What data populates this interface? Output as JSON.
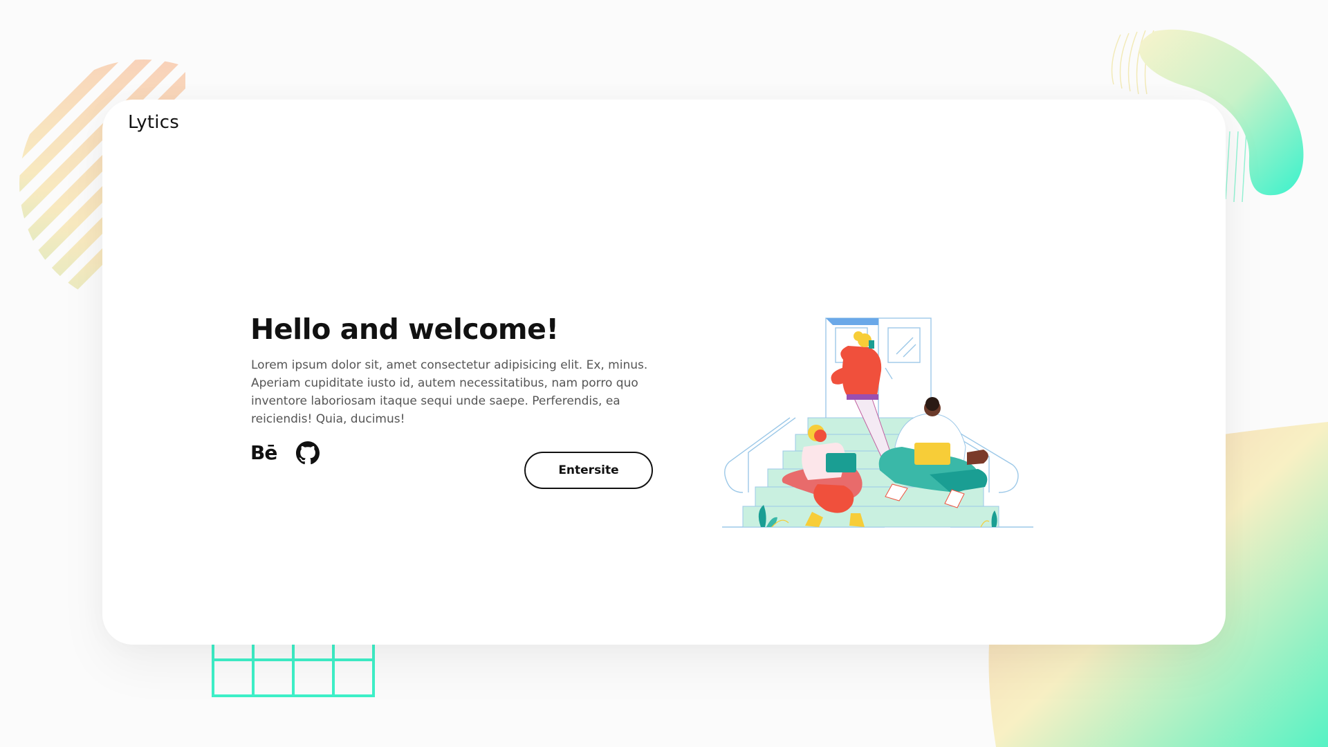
{
  "brand": {
    "logo": "Lytics"
  },
  "hero": {
    "title": "Hello and welcome!",
    "text": "Lorem ipsum dolor sit, amet consectetur adipisicing elit. Ex, minus. Aperiam cupiditate iusto id, autem necessitatibus, nam porro quo inventore laboriosam itaque sequi unde saepe. Perferendis, ea reiciendis! Quia, ducimus!",
    "button_label": "Entersite"
  },
  "socials": {
    "behance_label": "Bē",
    "items": [
      "behance-icon",
      "github-icon"
    ]
  },
  "colors": {
    "accent_teal": "#3ef0c8",
    "accent_yellow": "#f7f2c8",
    "accent_peach": "#f7c4b3",
    "person_red": "#f0503c",
    "person_pink": "#e86b6b",
    "person_teal": "#1a9e93",
    "laptop_yellow": "#f7cd38",
    "stairs_mint": "#c9f0e0",
    "outline_blue": "#9cc8e8"
  }
}
